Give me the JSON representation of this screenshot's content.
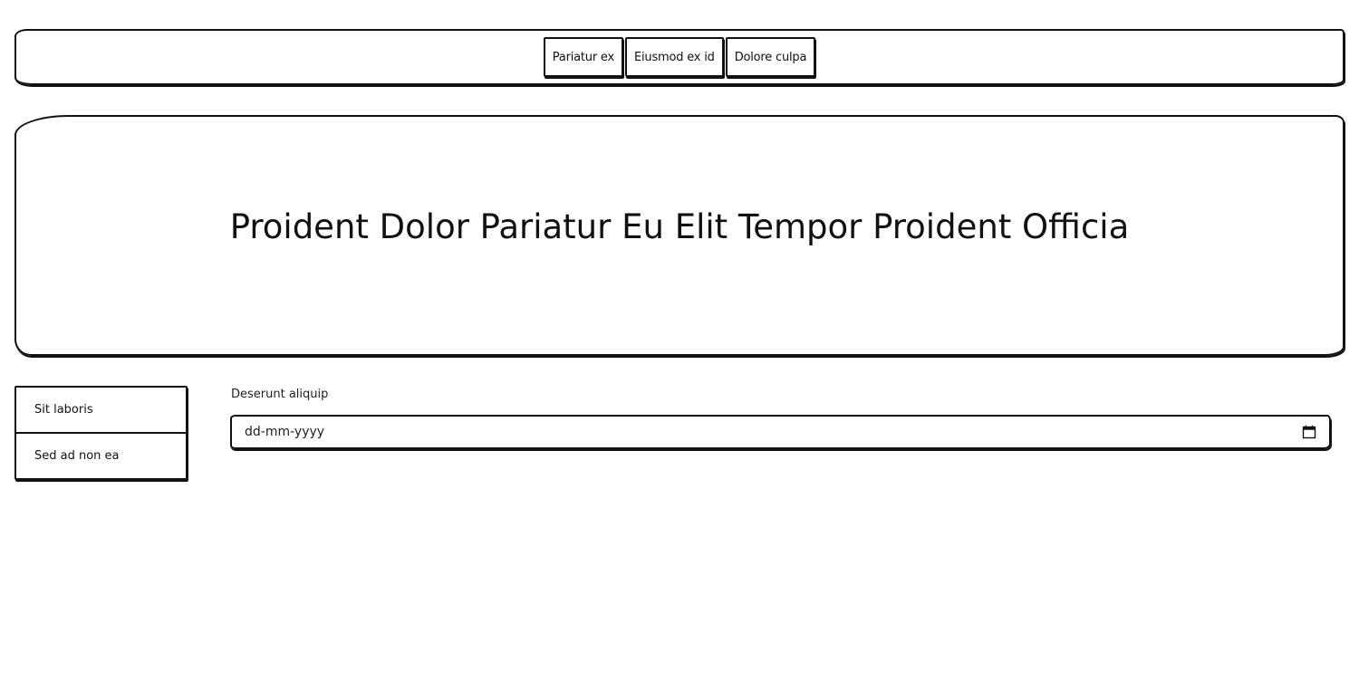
{
  "nav": {
    "items": [
      {
        "label": "Pariatur ex"
      },
      {
        "label": "Eiusmod ex id"
      },
      {
        "label": "Dolore culpa"
      }
    ]
  },
  "hero": {
    "title": "Proident Dolor Pariatur Eu Elit Tempor Proident Officia"
  },
  "sidebar": {
    "items": [
      {
        "label": "Sit laboris"
      },
      {
        "label": "Sed ad non ea"
      }
    ]
  },
  "form": {
    "date_field": {
      "label": "Deserunt aliquip",
      "placeholder": "dd-mm-yyyy",
      "icon": "calendar-icon"
    }
  }
}
